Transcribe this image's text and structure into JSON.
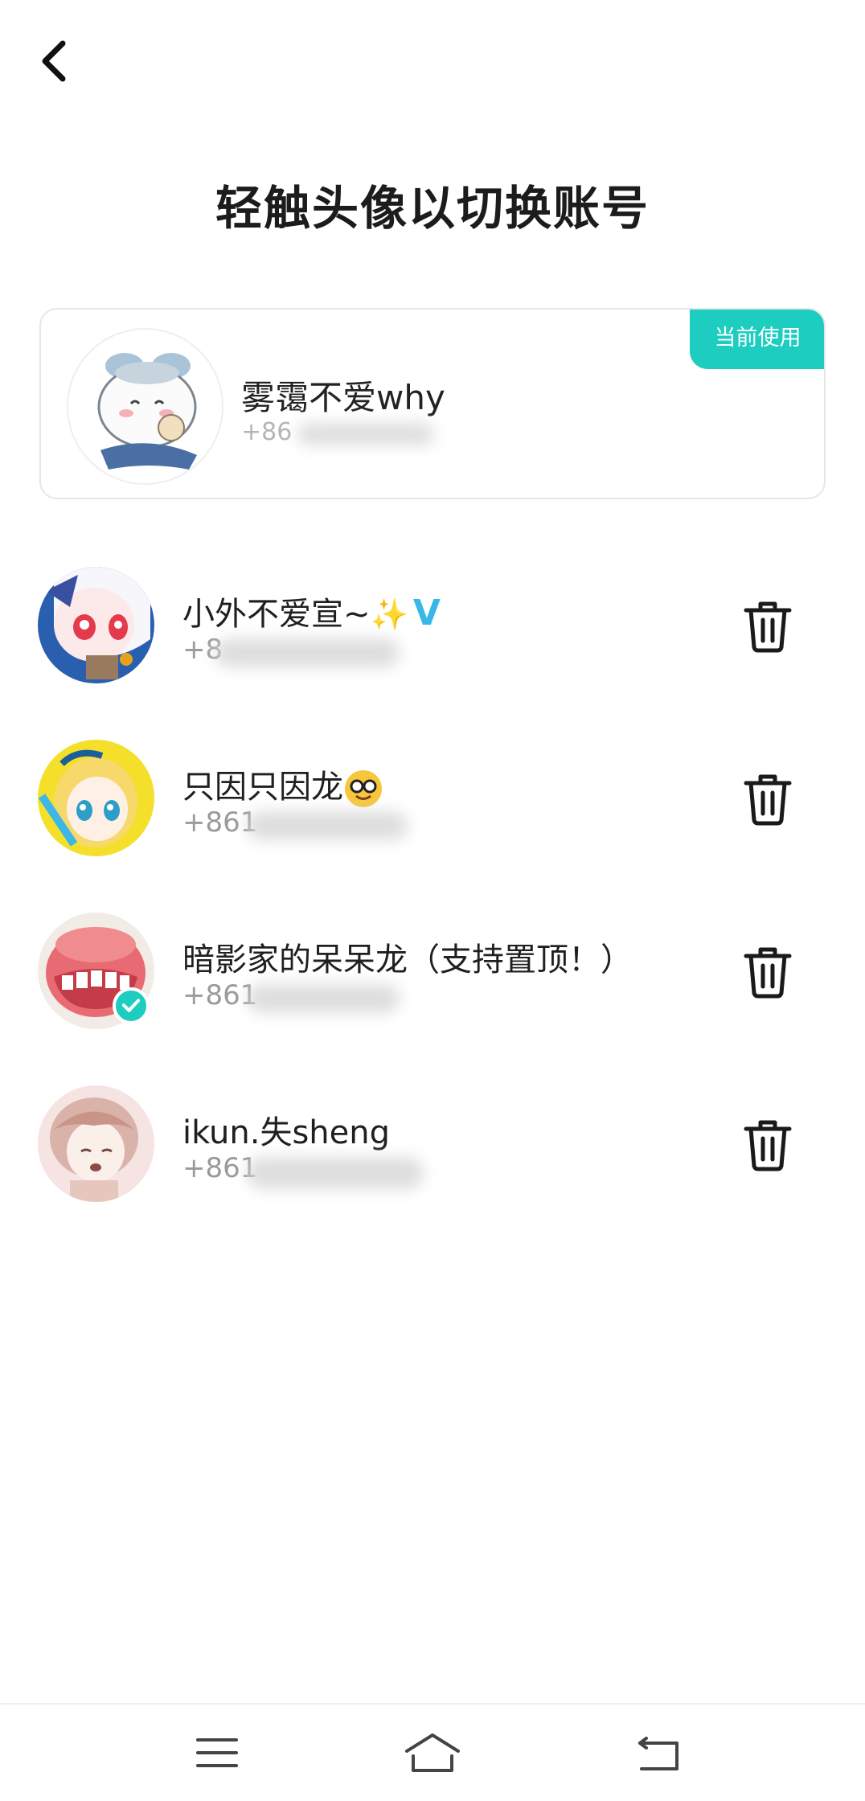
{
  "title": "轻触头像以切换账号",
  "current_account": {
    "badge": "当前使用",
    "name": "雾霭不爱why",
    "phone": "+86"
  },
  "accounts": [
    {
      "name": "小外不爱宣~",
      "emoji": "✨",
      "verified_mark": "V",
      "phone": "+8"
    },
    {
      "name": "只因只因龙",
      "emoji": "nerd-face-emoji",
      "phone": "+861"
    },
    {
      "name": "暗影家的呆呆龙（支持置顶！）",
      "phone": "+861"
    },
    {
      "name": "ikun.失sheng",
      "phone": "+861"
    }
  ],
  "colors": {
    "accent": "#1ccdc0",
    "text_primary": "#1f1f1f",
    "text_secondary": "#9a9a9a",
    "verified_v": "#38b8e8"
  },
  "icons": {
    "back": "chevron-left-icon",
    "delete": "trash-icon",
    "nav_menu": "menu-icon",
    "nav_home": "home-icon",
    "nav_back": "return-icon"
  }
}
